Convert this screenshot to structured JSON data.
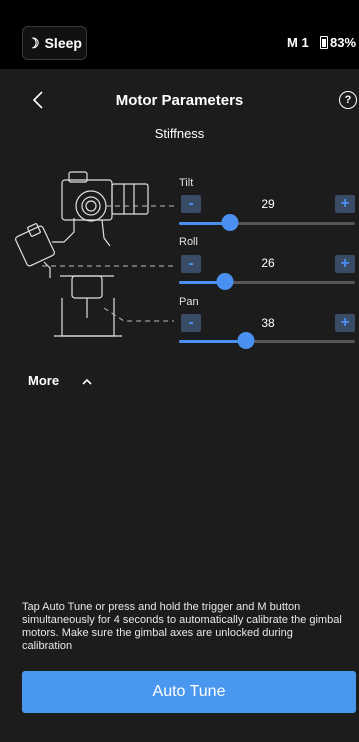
{
  "status_bar": {
    "sleep_label": "Sleep",
    "mode": "M 1",
    "battery": "83%"
  },
  "header": {
    "title": "Motor Parameters",
    "help": "?"
  },
  "subtitle": "Stiffness",
  "params": [
    {
      "label": "Tilt",
      "value": "29",
      "level": 0.29,
      "minus": "-",
      "plus": "+"
    },
    {
      "label": "Roll",
      "value": "26",
      "level": 0.26,
      "minus": "-",
      "plus": "+"
    },
    {
      "label": "Pan",
      "value": "38",
      "level": 0.38,
      "minus": "-",
      "plus": "+"
    }
  ],
  "more": {
    "label": "More"
  },
  "info_text": "Tap Auto Tune or press and hold the trigger and M button simultaneously for 4 seconds to automatically calibrate the gimbal motors. Make sure the gimbal axes are unlocked during calibration",
  "auto_tune_label": "Auto Tune",
  "colors": {
    "accent": "#4a90f0",
    "background": "#1c1c1c",
    "status_bar": "#000000"
  }
}
